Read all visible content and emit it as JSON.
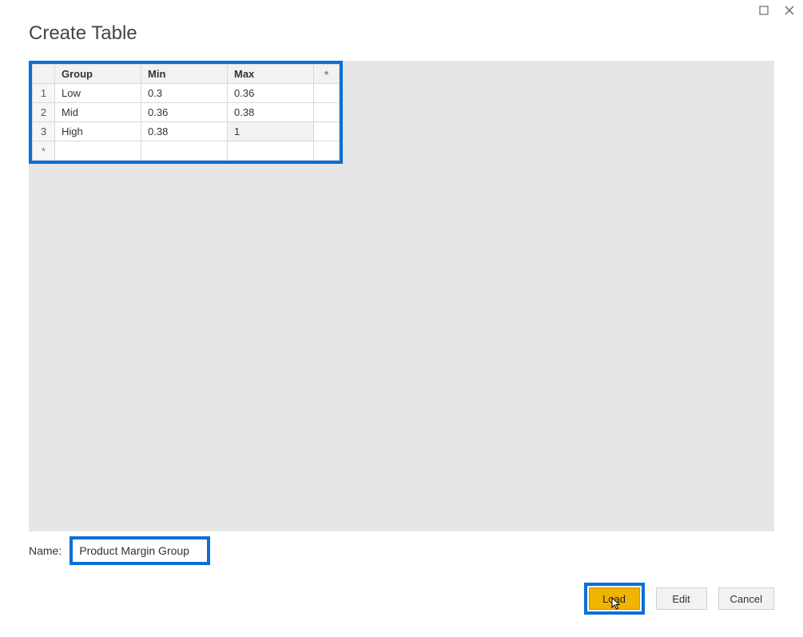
{
  "title": "Create Table",
  "window_controls": {
    "maximize_glyph": "▢",
    "close_glyph": "✕"
  },
  "grid": {
    "headers": {
      "group": "Group",
      "min": "Min",
      "max": "Max",
      "star": "*"
    },
    "rows": [
      {
        "num": "1",
        "group": "Low",
        "min": "0.3",
        "max": "0.36"
      },
      {
        "num": "2",
        "group": "Mid",
        "min": "0.36",
        "max": "0.38"
      },
      {
        "num": "3",
        "group": "High",
        "min": "0.38",
        "max": "1"
      }
    ],
    "new_row_glyph": "*"
  },
  "name_field": {
    "label": "Name:",
    "value": "Product Margin Group"
  },
  "buttons": {
    "load": "Load",
    "edit": "Edit",
    "cancel": "Cancel"
  }
}
